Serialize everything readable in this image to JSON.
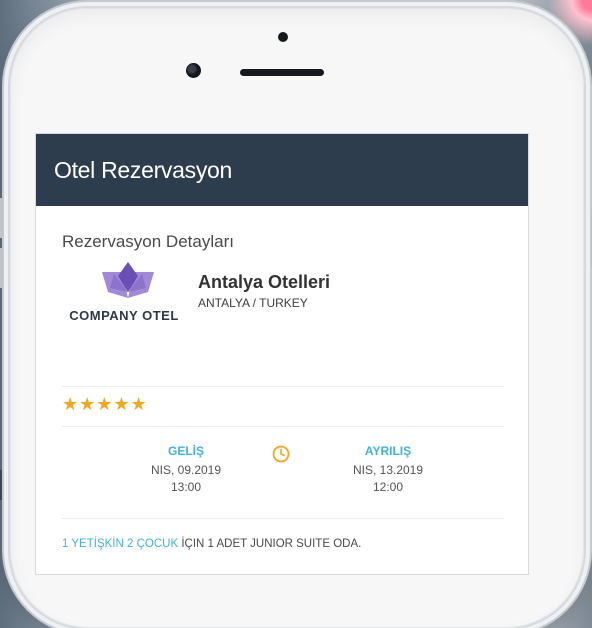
{
  "screen": {
    "title": "Otel Rezervasyon"
  },
  "details": {
    "section_title": "Rezervasyon Detayları"
  },
  "hotel": {
    "logo_text": "COMPANY OTEL",
    "name": "Antalya Otelleri",
    "location": "ANTALYA / TURKEY",
    "stars": "★★★★★"
  },
  "checkin": {
    "label": "GELİŞ",
    "date": "NIS, 09.2019",
    "time": "13:00"
  },
  "checkout": {
    "label": "AYRILIŞ",
    "date": "NIS, 13.2019",
    "time": "12:00"
  },
  "rooms": {
    "adults": "1 YETİŞKİN",
    "children": "2 ÇOCUK",
    "rest": "İÇIN 1 ADET JUNIOR SUITE ODA."
  },
  "colors": {
    "header_bg": "#2e3d4d",
    "accent": "#3fb3e1",
    "star": "#f2a81a",
    "clock": "#f2a81a",
    "logo_purple": "#7a5bc0",
    "logo_navy": "#2b3a49"
  },
  "icons": {
    "clock": "clock-icon",
    "logo": "company-logo-icon"
  }
}
